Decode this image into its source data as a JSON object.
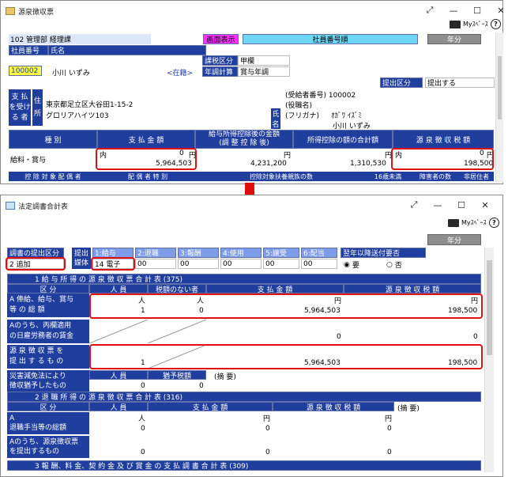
{
  "top": {
    "title": "源泉徴収票",
    "myspace": "Myｽﾍﾟｰｽ",
    "dept": "102 管理部 経理課",
    "emp_no_label": "社員番号",
    "name_label": "氏名",
    "emp_no": "100002",
    "emp_name": "小川 いずみ",
    "status": "<在籍>",
    "screen_display": "画面表示",
    "sort_order": "社員番号順",
    "year_btn": "年分",
    "tax_class_label": "課税区分",
    "tax_class": "甲欄",
    "adjust_label": "年調計算",
    "adjust": "賞与年調",
    "submit_label": "提出区分",
    "submit": "提出する",
    "payee_label": [
      "支 払",
      "を受け",
      "る 者"
    ],
    "addr_label": [
      "住",
      "所"
    ],
    "address1": "東京都足立区大谷田1-15-2",
    "address2": "グロリアハイツ103",
    "recipient_no": "(受給者番号) 100002",
    "position": "(役職名)",
    "furigana": "(フリガナ)",
    "furigana_val": "ｵｶﾞﾜ ｲｽﾞﾐ",
    "name_sub": "小川 いずみ",
    "name_side": [
      "氏",
      "名"
    ],
    "col_type": "種 別",
    "col_pay": "支 払 金 額",
    "col_after": "給与所得控除後の金額",
    "col_after2": "(調 整 控 除 後)",
    "col_total_deduct": "所得控除の額の合計額",
    "col_tax": "源 泉 徴 収 税 額",
    "row_type": "給料・賞与",
    "inner": "内",
    "yen": "円",
    "pay_inner": "0",
    "pay_amount": "5,964,503",
    "after_amount": "4,231,200",
    "deduct_amount": "1,310,530",
    "tax_inner": "0",
    "tax_amount": "198,500",
    "footer1": "控 除 対 象 配 偶 者",
    "footer2": "配 偶 者 特 別",
    "footer3": "控除対象扶養親族の数",
    "footer4": "16歳未満",
    "footer5": "障害者の数",
    "footer6": "非居住者"
  },
  "bottom": {
    "title": "法定調書合計表",
    "myspace": "Myｽﾍﾟｰｽ",
    "year_btn": "年分",
    "submit_cat_label": "調書の提出区分",
    "submit_cat": "2 追加",
    "medium_label": [
      "提出",
      "媒体"
    ],
    "tabs": [
      "1:給与",
      "2:退職",
      "3:報酬",
      "4:使用",
      "5:譲受",
      "6:配当"
    ],
    "medium": "14 電子",
    "vals": [
      "00",
      "00",
      "00",
      "00",
      "00",
      "00"
    ],
    "next_year_label": "翌年以降送付要否",
    "radio_yes": "要",
    "radio_no": "否",
    "sec1": "1 給 与 所 得 の 源 泉 徴 収 票 合 計 表 (375)",
    "h_kubun": "区 分",
    "h_people": "人 員",
    "h_no_tax": "税額のない者",
    "h_pay": "支 払 金 額",
    "h_tax": "源 泉 徴 収 税 額",
    "unit_person": "人",
    "unit_yen": "円",
    "rowA": [
      "A 俸給、給与、賞与",
      "等 の 総 額"
    ],
    "rowA_people": "1",
    "rowA_notax": "0",
    "rowA_pay": "5,964,503",
    "rowA_tax": "198,500",
    "rowB": [
      "Aのうち、丙欄適用",
      "の日雇労務者の賃金"
    ],
    "rowB_pay": "0",
    "rowB_tax": "0",
    "rowC": [
      "源 泉 徴 収 票 を",
      "提 出 す る も の"
    ],
    "rowC_people": "1",
    "rowC_pay": "5,964,503",
    "rowC_tax": "198,500",
    "rowD": [
      "災害減免法により",
      "徴収猶予したもの"
    ],
    "rowD_people_h": "人 員",
    "rowD_tax_h": "猶予税額",
    "rowD_remark": "(摘 要)",
    "rowD_people": "0",
    "rowD_tax": "0",
    "sec2": "2 退 職 所 得 の 源 泉 徴 収 票 合 計 表 (316)",
    "h2_kubun": "区 分",
    "h2_people": "人 員",
    "h2_pay": "支 払 金 額",
    "h2_tax": "源 泉 徴 収 税 額",
    "h2_remark": "(摘 要)",
    "r2A": [
      "A",
      "退職手当等の総額"
    ],
    "r2A_people": "0",
    "r2A_pay": "0",
    "r2A_tax": "0",
    "r2B": [
      "Aのうち、源泉徴収票",
      "を提出するもの"
    ],
    "r2B_people": "0",
    "r2B_pay": "0",
    "r2B_tax": "0",
    "sec3": "3 報 酬、料 金、契 約 金 及 び 賞 金 の 支 払 調 書 合 計 表 (309)"
  },
  "colors": {
    "accent": "#1f3e9d",
    "red": "#e01010",
    "pale": "#dce8f9"
  }
}
